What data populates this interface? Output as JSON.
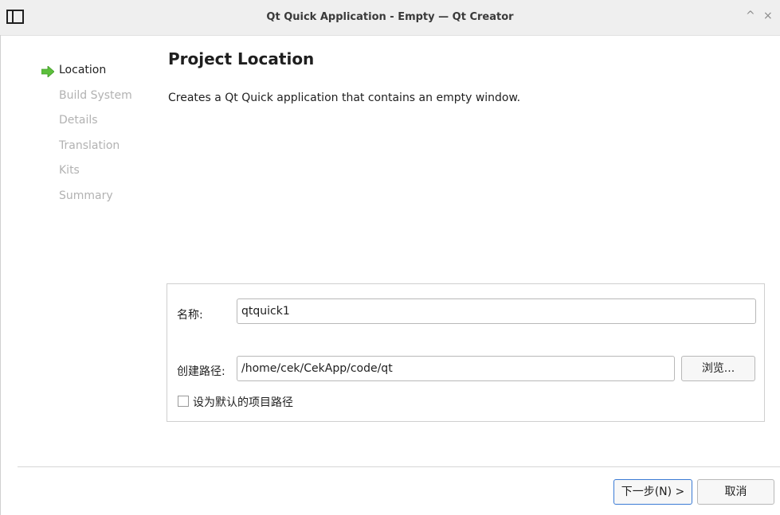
{
  "window": {
    "title": "Qt Quick Application - Empty — Qt Creator",
    "max_glyph": "^",
    "close_glyph": "×"
  },
  "sidebar": {
    "items": [
      {
        "label": "Location",
        "active": true
      },
      {
        "label": "Build System",
        "active": false
      },
      {
        "label": "Details",
        "active": false
      },
      {
        "label": "Translation",
        "active": false
      },
      {
        "label": "Kits",
        "active": false
      },
      {
        "label": "Summary",
        "active": false
      }
    ],
    "current_icon": "green-right-arrow-icon",
    "accent_color": "#5cbf3c"
  },
  "main": {
    "title": "Project Location",
    "description": "Creates a Qt Quick application that contains an empty window."
  },
  "form": {
    "name_label": "名称:",
    "name_value": "qtquick1",
    "path_label": "创建路径:",
    "path_value": "/home/cek/CekApp/code/qt",
    "browse_label": "浏览...",
    "default_path_label": "设为默认的项目路径",
    "default_path_checked": false
  },
  "footer": {
    "next_label": "下一步(N) >",
    "cancel_label": "取消"
  }
}
